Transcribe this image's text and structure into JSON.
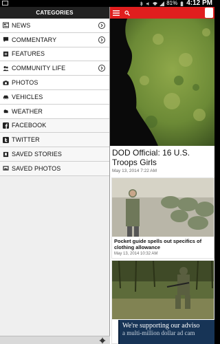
{
  "status_bar": {
    "battery": "81%",
    "time": "4:12 PM"
  },
  "drawer": {
    "title": "CATEGORIES",
    "items": [
      {
        "label": "NEWS",
        "icon": "newspaper-icon",
        "has_arrow": true
      },
      {
        "label": "COMMENTARY",
        "icon": "speech-bubble-icon",
        "has_arrow": true
      },
      {
        "label": "FEATURES",
        "icon": "doc-icon",
        "has_arrow": false
      },
      {
        "label": "COMMUNITY LIFE",
        "icon": "people-icon",
        "has_arrow": true
      },
      {
        "label": "PHOTOS",
        "icon": "camera-icon",
        "has_arrow": false
      },
      {
        "label": "VEHICLES",
        "icon": "car-icon",
        "has_arrow": false
      },
      {
        "label": "WEATHER",
        "icon": "cloud-icon",
        "has_arrow": false
      },
      {
        "label": "FACEBOOK",
        "icon": "facebook-icon",
        "has_arrow": false
      },
      {
        "label": "TWITTER",
        "icon": "twitter-icon",
        "has_arrow": false
      },
      {
        "label": "SAVED STORIES",
        "icon": "bookmark-icon",
        "has_arrow": false
      },
      {
        "label": "SAVED PHOTOS",
        "icon": "saved-photos-icon",
        "has_arrow": false
      }
    ]
  },
  "main": {
    "hero": {
      "title": "DOD Official: 16 U.S. Troops Girls",
      "date": "May 13, 2014 7:22 AM"
    },
    "articles": [
      {
        "title": "Pocket guide spells out specifics of clothing allowance",
        "date": "May 13, 2014 10:32 AM"
      },
      {
        "title": "",
        "date": ""
      }
    ]
  },
  "ad": {
    "line1": "We're supporting our adviso",
    "line2": "a multi-million dollar ad cam"
  },
  "colors": {
    "topbar": "#e01e1e",
    "drawer_header": "#222222",
    "ad_bg": "#173456"
  }
}
